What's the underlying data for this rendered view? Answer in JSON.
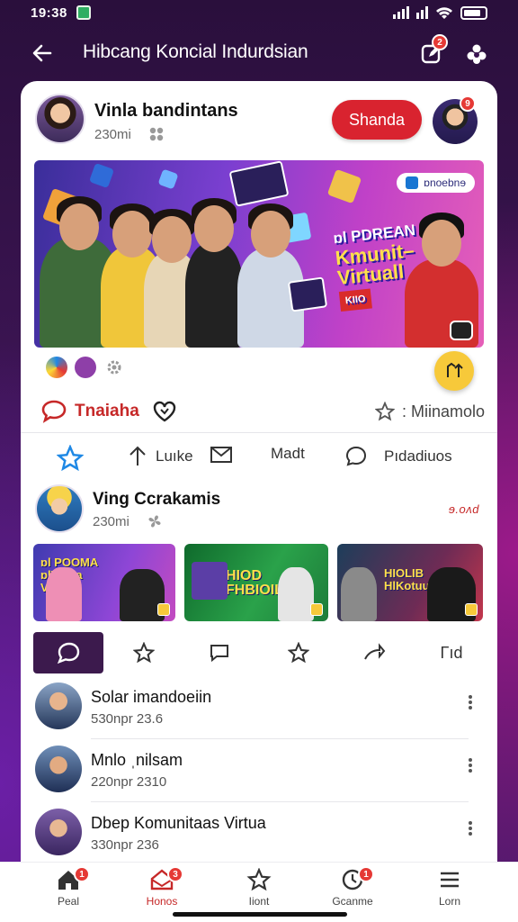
{
  "status_bar": {
    "time": "19:38",
    "app_icon": "notification-app-icon",
    "icons": [
      "signal-icon",
      "wifi-icon",
      "battery-icon"
    ]
  },
  "top_bar": {
    "title": "Hibcang Koncial Indurdsian",
    "back_icon": "back-arrow-icon",
    "edit_badge": "2",
    "settings_icon": "settings-icon"
  },
  "post": {
    "author": "Vinla bandintans",
    "meta": "230mi",
    "share_label": "Shanda",
    "share_avatar_badge": "9",
    "banner": {
      "pill_text": "ɒnoebnɘ",
      "headline_line1": "ɒl PDREAN",
      "headline_line2": "Kmunit–",
      "headline_line3": "Virtuall",
      "tag": "KIIO"
    },
    "like_label": "Tnaiaha",
    "right_meta": ": Miinamolo"
  },
  "actions": [
    {
      "icon": "star-icon",
      "label": ""
    },
    {
      "icon": "upload-icon",
      "label": "Luıke"
    },
    {
      "icon": "mail-icon",
      "label": ""
    },
    {
      "icon": "",
      "label": "Madt"
    },
    {
      "icon": "chat-bubble-icon",
      "label": "Pıdadiuos"
    }
  ],
  "post2": {
    "author": "Ving Ccrakamis",
    "meta": "230mi",
    "tag": "ɘ.oʌd",
    "thumbs": [
      {
        "label": "ɒl POOMA ɒlVunla Vırtual"
      },
      {
        "label": "HIOD FHBIOIL"
      },
      {
        "label": "HIOLIB HlKotuu"
      }
    ]
  },
  "tabs": [
    {
      "icon": "chat-icon",
      "active": true
    },
    {
      "icon": "star-outline-icon",
      "active": false
    },
    {
      "icon": "message-icon",
      "active": false
    },
    {
      "icon": "star-outline-icon",
      "active": false
    },
    {
      "icon": "share-arrow-icon",
      "active": false
    },
    {
      "icon": "text-icon",
      "label": "Γıd",
      "active": false
    }
  ],
  "list": [
    {
      "name": "Solar imandoeiin",
      "sub": "530npr 23.6"
    },
    {
      "name": "Mnlo ˌnilsam",
      "sub": "220npr 2310"
    },
    {
      "name": "Dbep Komunitaas Virtua",
      "sub": "330npr 236"
    }
  ],
  "bottom_nav": [
    {
      "label": "Peal",
      "icon": "home-icon",
      "badge": "1",
      "active": false
    },
    {
      "label": "Honos",
      "icon": "mail-home-icon",
      "badge": "3",
      "active": true
    },
    {
      "label": "Iiont",
      "icon": "star-icon",
      "badge": "",
      "active": false
    },
    {
      "label": "Gcanme",
      "icon": "clock-icon",
      "badge": "1",
      "active": false
    },
    {
      "label": "Lorn",
      "icon": "menu-icon",
      "badge": "",
      "active": false
    }
  ],
  "colors": {
    "accent": "#d9232f",
    "fab": "#f7c93a",
    "tab_active": "#3c1a4d"
  }
}
